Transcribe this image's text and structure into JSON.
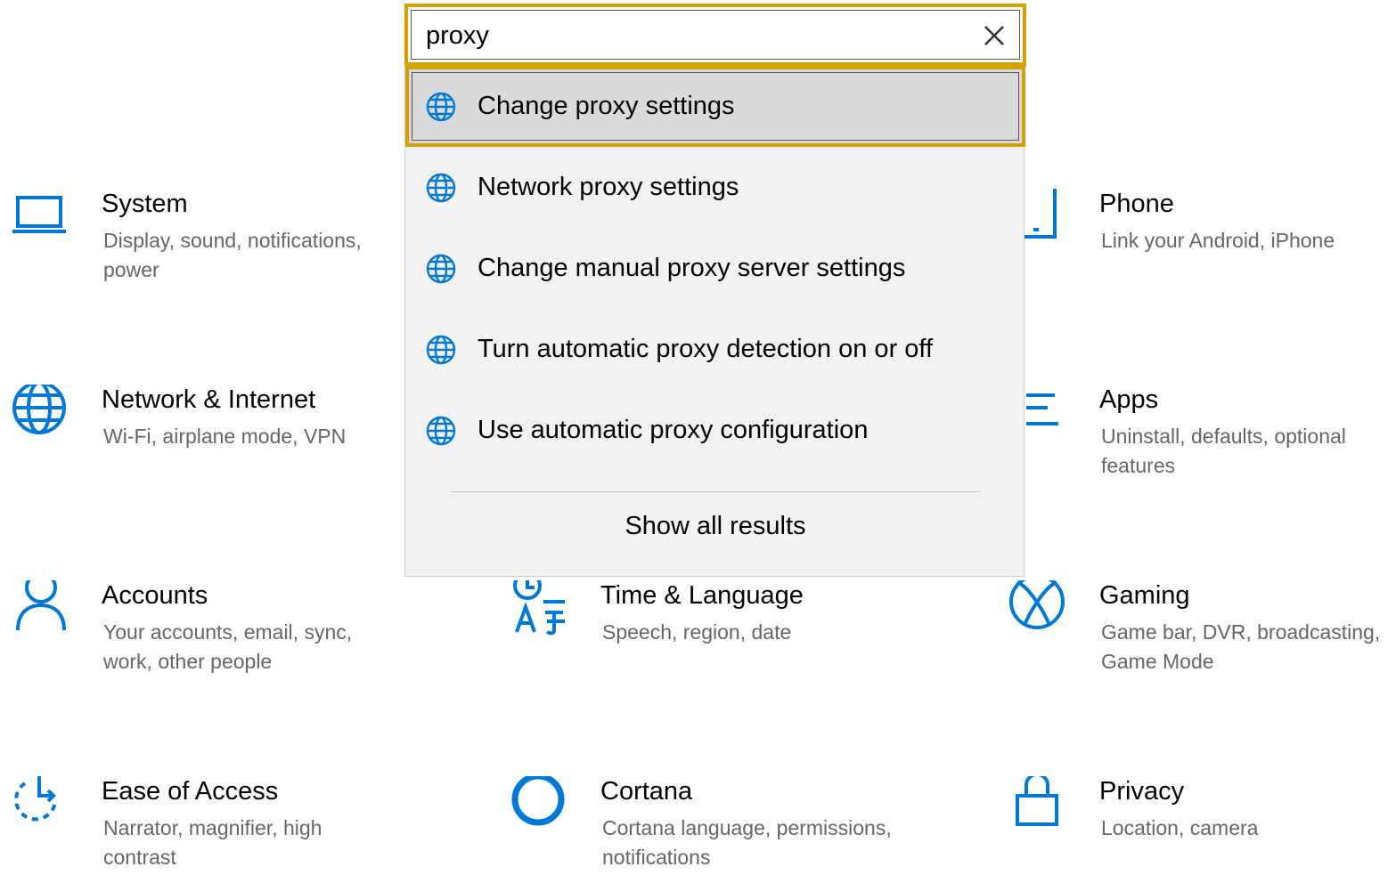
{
  "search": {
    "value": "proxy",
    "suggestions": [
      "Change proxy settings",
      "Network proxy settings",
      "Change manual proxy server settings",
      "Turn automatic proxy detection on or off",
      "Use automatic proxy configuration"
    ],
    "show_all": "Show all results"
  },
  "categories": {
    "system": {
      "title": "System",
      "desc": "Display, sound, notifications, power"
    },
    "phone": {
      "title": "Phone",
      "desc": "Link your Android, iPhone"
    },
    "network": {
      "title": "Network & Internet",
      "desc": "Wi-Fi, airplane mode, VPN"
    },
    "apps": {
      "title": "Apps",
      "desc": "Uninstall, defaults, optional features"
    },
    "accounts": {
      "title": "Accounts",
      "desc": "Your accounts, email, sync, work, other people"
    },
    "time": {
      "title": "Time & Language",
      "desc": "Speech, region, date"
    },
    "gaming": {
      "title": "Gaming",
      "desc": "Game bar, DVR, broadcasting, Game Mode"
    },
    "ease": {
      "title": "Ease of Access",
      "desc": "Narrator, magnifier, high contrast"
    },
    "cortana": {
      "title": "Cortana",
      "desc": "Cortana language, permissions, notifications"
    },
    "privacy": {
      "title": "Privacy",
      "desc": "Location, camera"
    }
  },
  "colors": {
    "accent": "#0078d7",
    "focus": "#d5a102",
    "dropdown_bg": "#f2f2f2",
    "selected_bg": "#dadada",
    "desc_text": "#666666"
  }
}
